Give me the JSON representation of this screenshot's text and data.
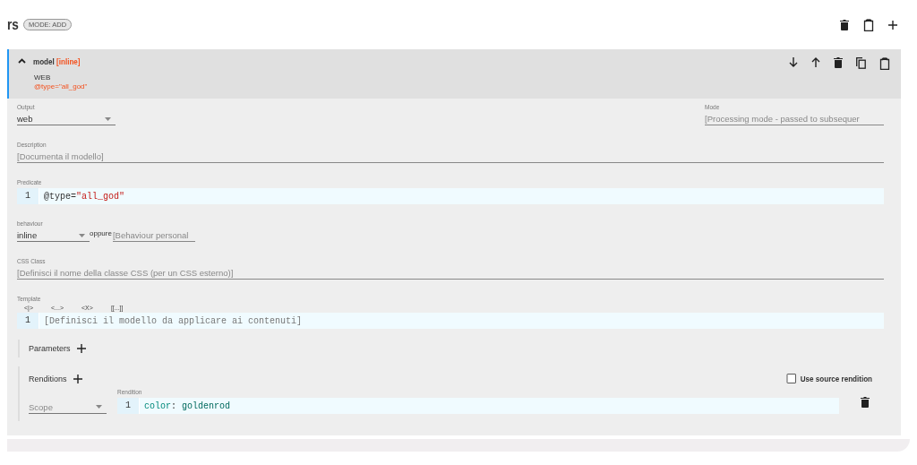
{
  "title": "rs",
  "mode_badge": "MODE: ADD",
  "model": {
    "expanded": true,
    "name": "model",
    "behaviour_tag": "[inline]",
    "output_summary": "WEB",
    "predicate_summary": "@type=\"all_god\"",
    "output": {
      "label": "Output",
      "value": "web"
    },
    "mode": {
      "label": "Mode",
      "placeholder": "[Processing mode - passed to subsequer"
    },
    "description": {
      "label": "Description",
      "placeholder": "[Documenta il modello]"
    },
    "predicate": {
      "label": "Predicate",
      "lines": [
        {
          "number": "1",
          "tokens": [
            {
              "kind": "attr",
              "text": "@type="
            },
            {
              "kind": "string",
              "text": "\"all_god\""
            }
          ]
        }
      ]
    },
    "behaviour": {
      "label": "behaviour",
      "value": "inline",
      "or_text": "oppure",
      "placeholder": "[Behaviour personal"
    },
    "css_class": {
      "label": "CSS Class",
      "placeholder": "[Definisci il nome della classe CSS (per un CSS esterno)]"
    },
    "template": {
      "label": "Template",
      "tools": [
        "<|>",
        "<...>",
        "<X>",
        "[[...]]"
      ],
      "line_number": "1",
      "placeholder": "[Definisci il modello da applicare ai contenuti]"
    },
    "parameters": {
      "label": "Parameters"
    },
    "renditions": {
      "label": "Renditions",
      "use_source": {
        "label": "Use source rendition",
        "checked": false
      },
      "rows": [
        {
          "scope_placeholder": "Scope",
          "label": "Rendition",
          "lines": [
            {
              "number": "1",
              "tokens": [
                {
                  "kind": "property",
                  "text": "color"
                },
                {
                  "kind": "punct",
                  "text": ": "
                },
                {
                  "kind": "value",
                  "text": "goldenrod"
                }
              ]
            }
          ]
        }
      ]
    }
  }
}
